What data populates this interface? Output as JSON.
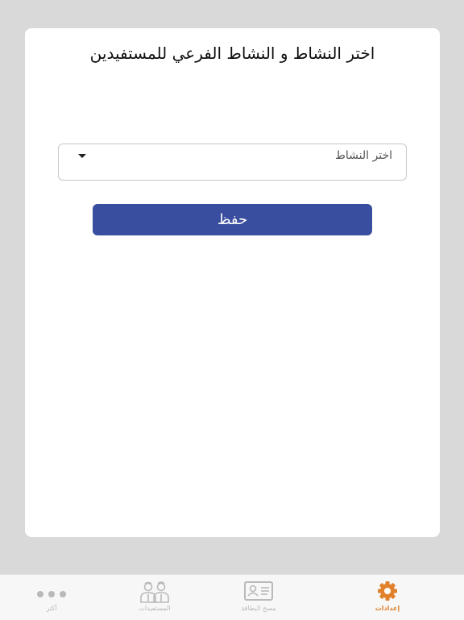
{
  "title": "اختر النشاط و النشاط الفرعي للمستفيدين",
  "activity_select": {
    "placeholder": "اختر النشاط"
  },
  "save_button": {
    "label": "حفظ"
  },
  "tabs": [
    {
      "label": "إعدادات",
      "icon": "gear-icon",
      "active": true
    },
    {
      "label": "مسح البطاقة",
      "icon": "id-card-icon",
      "active": false
    },
    {
      "label": "المستفيدات",
      "icon": "people-icon",
      "active": false
    },
    {
      "label": "أكثر",
      "icon": "more-dots-icon",
      "active": false
    }
  ],
  "colors": {
    "primary": "#3a4ea0",
    "accent": "#e1812c",
    "inactive": "#b9b9b9"
  }
}
